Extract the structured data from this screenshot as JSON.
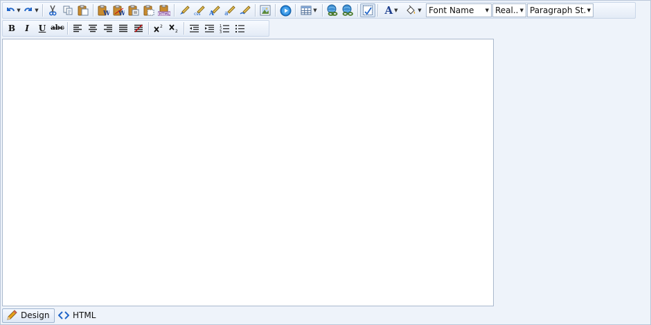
{
  "toolbar": {
    "font_name": "Font Name",
    "font_size": "Real...",
    "paragraph_style": "Paragraph St...",
    "font_color_letter": "A"
  },
  "format": {
    "bold": "B",
    "italic": "I",
    "underline": "U",
    "strike": "abc"
  },
  "modes": {
    "design": "Design",
    "html": "HTML"
  },
  "colors": {
    "accent": "#1f64c8",
    "toolbar_border": "#c9d6e8",
    "background": "#eef3fa"
  }
}
